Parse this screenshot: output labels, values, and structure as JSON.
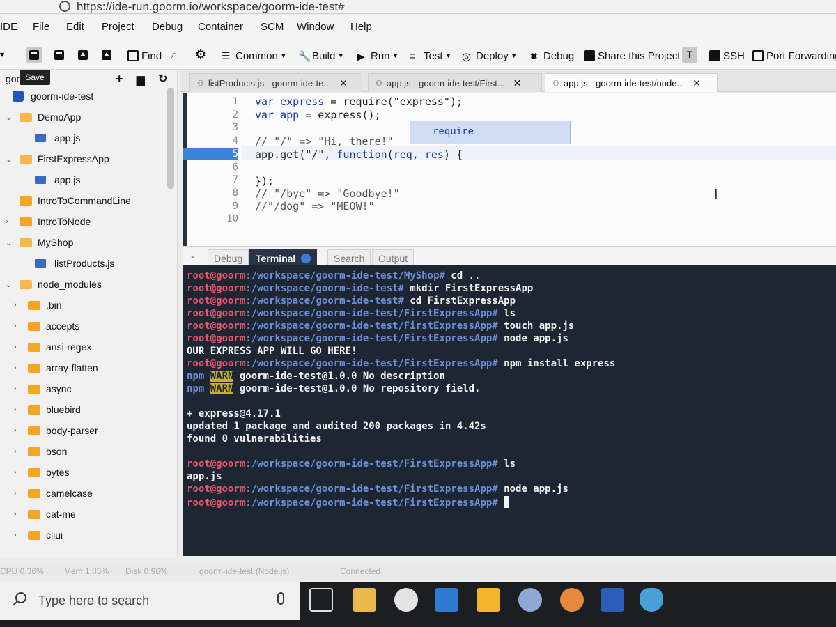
{
  "browser": {
    "url": "https://ide-run.goorm.io/workspace/goorm-ide-test#"
  },
  "menu": [
    "IDE",
    "File",
    "Edit",
    "Project",
    "Debug",
    "Container",
    "SCM",
    "Window",
    "Help"
  ],
  "toolbar": {
    "find": "Find",
    "common": "Common",
    "build": "Build",
    "run": "Run",
    "test": "Test",
    "deploy": "Deploy",
    "debug": "Debug",
    "share": "Share this Project",
    "ssh": "SSH",
    "port_forwarding": "Port Forwarding",
    "tooltip": "Save"
  },
  "sidebar": {
    "project_label": "goo   krHG",
    "items": [
      {
        "label": "goorm-ide-test",
        "kind": "project",
        "arrow": "⌄"
      },
      {
        "label": "DemoApp",
        "kind": "folder-open",
        "arrow": "⌄"
      },
      {
        "label": "app.js",
        "kind": "file",
        "arrow": ""
      },
      {
        "label": "FirstExpressApp",
        "kind": "folder-open",
        "arrow": "⌄"
      },
      {
        "label": "app.js",
        "kind": "file",
        "arrow": ""
      },
      {
        "label": "IntroToCommandLine",
        "kind": "folder",
        "arrow": ""
      },
      {
        "label": "IntroToNode",
        "kind": "folder",
        "arrow": "›"
      },
      {
        "label": "MyShop",
        "kind": "folder-open",
        "arrow": "⌄"
      },
      {
        "label": "listProducts.js",
        "kind": "file",
        "arrow": ""
      },
      {
        "label": "node_modules",
        "kind": "folder-open",
        "arrow": "⌄"
      },
      {
        "label": ".bin",
        "kind": "folder",
        "arrow": "›"
      },
      {
        "label": "accepts",
        "kind": "folder",
        "arrow": "›"
      },
      {
        "label": "ansi-regex",
        "kind": "folder",
        "arrow": "›"
      },
      {
        "label": "array-flatten",
        "kind": "folder",
        "arrow": "›"
      },
      {
        "label": "async",
        "kind": "folder",
        "arrow": "›"
      },
      {
        "label": "bluebird",
        "kind": "folder",
        "arrow": "›"
      },
      {
        "label": "body-parser",
        "kind": "folder",
        "arrow": "›"
      },
      {
        "label": "bson",
        "kind": "folder",
        "arrow": "›"
      },
      {
        "label": "bytes",
        "kind": "folder",
        "arrow": "›"
      },
      {
        "label": "camelcase",
        "kind": "folder",
        "arrow": "›"
      },
      {
        "label": "cat-me",
        "kind": "folder",
        "arrow": "›"
      },
      {
        "label": "cliui",
        "kind": "folder",
        "arrow": "›"
      }
    ]
  },
  "tabs": [
    {
      "label": "listProducts.js - goorm-ide-te..."
    },
    {
      "label": "app.js - goorm-ide-test/First..."
    },
    {
      "label": "app.js - goorm-ide-test/node..."
    }
  ],
  "editor": {
    "line_numbers": [
      "1",
      "2",
      "3",
      "4",
      "5",
      "6",
      "7",
      "8",
      "9",
      "10"
    ],
    "current_line": 5,
    "autocomplete": "require"
  },
  "panel_tabs": {
    "debug": "Debug",
    "terminal": "Terminal",
    "search": "Search",
    "output": "Output"
  },
  "terminal": {
    "user": "root@goorm",
    "lines": [
      {
        "path": ":/workspace/goorm-ide-test/MyShop#",
        "cmd": " cd .."
      },
      {
        "path": ":/workspace/goorm-ide-test#",
        "cmd": " mkdir FirstExpressApp"
      },
      {
        "path": ":/workspace/goorm-ide-test#",
        "cmd": " cd FirstExpressApp"
      },
      {
        "path": ":/workspace/goorm-ide-test/FirstExpressApp#",
        "cmd": " ls"
      },
      {
        "path": ":/workspace/goorm-ide-test/FirstExpressApp#",
        "cmd": " touch app.js"
      },
      {
        "path": ":/workspace/goorm-ide-test/FirstExpressApp#",
        "cmd": " node app.js"
      }
    ],
    "output1": "OUR EXPRESS APP WILL GO HERE!",
    "npm_install": {
      "path": ":/workspace/goorm-ide-test/FirstExpressApp#",
      "cmd": " npm install express"
    },
    "warn1": {
      "npm": "npm",
      "warn": "WARN",
      "msg": " goorm-ide-test@1.0.0 No description"
    },
    "warn2": {
      "npm": "npm",
      "warn": "WARN",
      "msg": " goorm-ide-test@1.0.0 No repository field."
    },
    "install_lines": [
      "+ express@4.17.1",
      "updated 1 package and audited 200 packages in 4.42s",
      "found 0 vulnerabilities"
    ],
    "ls2": {
      "path": ":/workspace/goorm-ide-test/FirstExpressApp#",
      "cmd": " ls"
    },
    "ls_out": "app.js",
    "node2": {
      "path": ":/workspace/goorm-ide-test/FirstExpressApp#",
      "cmd": " node app.js"
    },
    "prompt": {
      "path": ":/workspace/goorm-ide-test/FirstExpressApp#"
    }
  },
  "status": {
    "cpu": "CPU 0.36%",
    "mem": "Mem 1.83%",
    "disk": "Disk 0.96%",
    "task": "goorm-ide-test (Node.js)",
    "connected": "Connected"
  },
  "taskbar": {
    "search_placeholder": "Type here to search"
  },
  "colors": {
    "terminal_bg": "#1f2633",
    "user": "#e7556b",
    "path": "#6a8fd8",
    "warn": "#c9b21a",
    "accent": "#3c82d6"
  }
}
